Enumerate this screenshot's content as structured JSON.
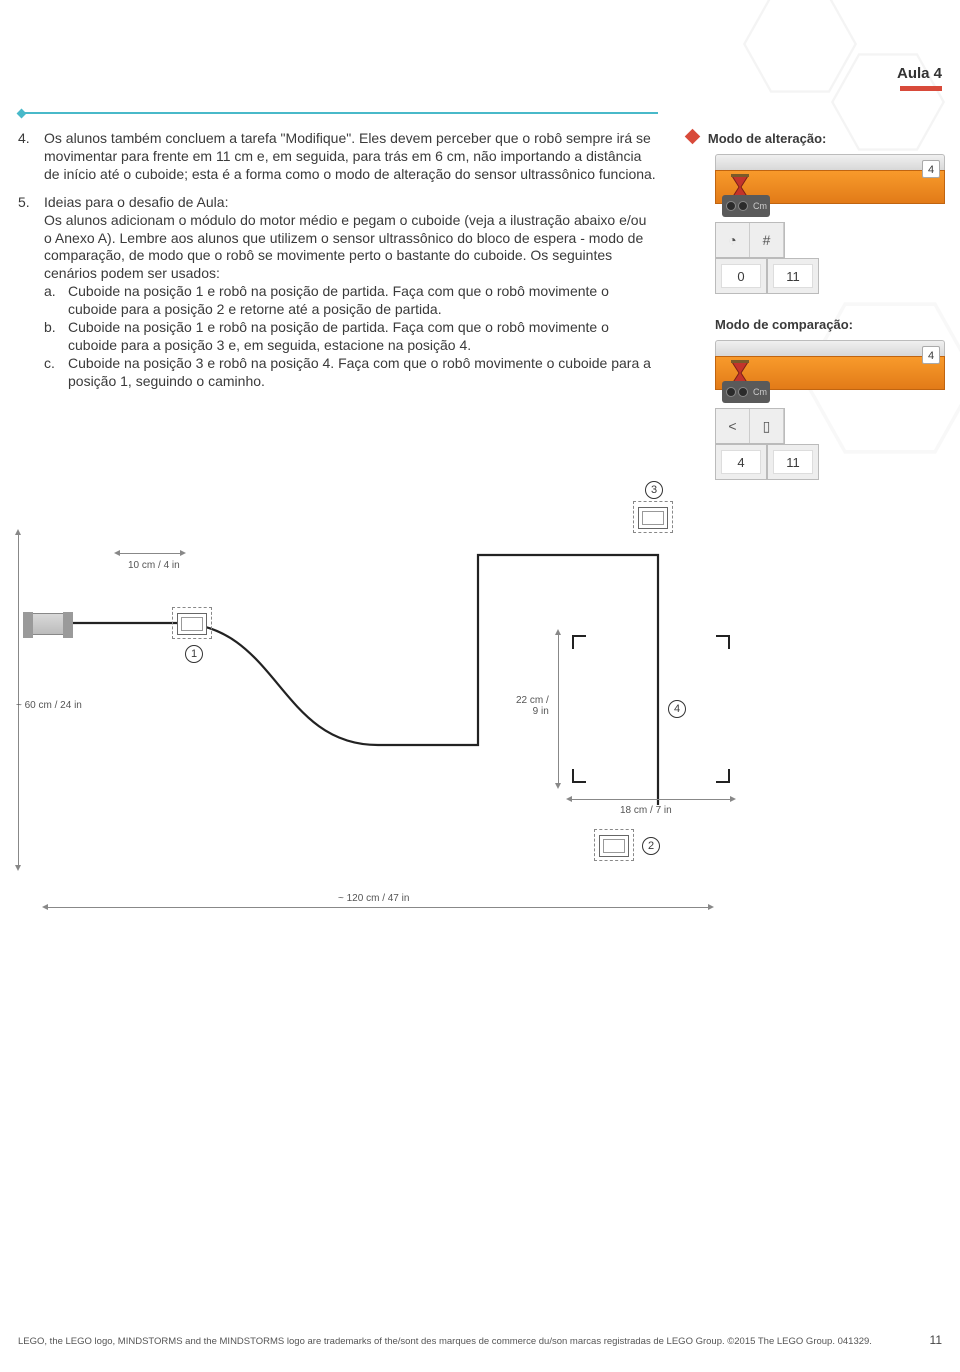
{
  "page": {
    "header": "Aula 4",
    "number": "11"
  },
  "body": {
    "p4_marker": "4.",
    "p4": "Os alunos também concluem a tarefa \"Modifique\". Eles devem perceber que o robô sempre irá se movimentar para frente em 11 cm e, em seguida, para trás em 6 cm, não importando a distância de início até o cuboide; esta é a forma como o modo de alteração do sensor ultrassônico funciona.",
    "p5_marker": "5.",
    "p5_intro": "Ideias para o desafio de Aula:",
    "p5_body1": "Os alunos adicionam o módulo do motor médio e pegam o cuboide (veja a ilustração abaixo e/ou o Anexo A). Lembre aos alunos que utilizem o sensor ultrassônico do bloco de espera - modo de comparação, de modo que o robô se movimente perto o bastante do cuboide. Os seguintes cenários podem ser usados:",
    "a_marker": "a.",
    "a": "Cuboide na posição 1 e robô na posição de partida. Faça com que o robô movimente o cuboide para a posição 2 e retorne até a posição de partida.",
    "b_marker": "b.",
    "b": "Cuboide na posição 1 e robô na posição de partida. Faça com que o robô movimente o cuboide para a posição 3 e, em seguida, estacione na posição 4.",
    "c_marker": "c.",
    "c": "Cuboide na posição 3 e robô na posição 4. Faça com que o robô movimente o cuboide para a posição 1, seguindo o caminho."
  },
  "right": {
    "label1": "Modo de alteração:",
    "label2": "Modo de comparação:",
    "block1": {
      "port": "4",
      "p1_icon": "◔",
      "p1_val": "#",
      "p2_val1": "0",
      "p2_val2": "11"
    },
    "block2": {
      "port": "4",
      "p1_icon": "<",
      "p1_val": "▯",
      "p2_val1": "4",
      "p2_val2": "11"
    }
  },
  "diagram": {
    "m_10cm": "10 cm / 4 in",
    "m_60cm": "~ 60 cm / 24 in",
    "m_22cm": "22 cm /\n9 in",
    "m_18cm": "18 cm / 7 in",
    "m_120cm": "~ 120 cm / 47 in",
    "n1": "1",
    "n2": "2",
    "n3": "3",
    "n4": "4"
  },
  "footer": {
    "line": "LEGO, the LEGO logo, MINDSTORMS and the MINDSTORMS logo are trademarks of the/sont des marques de commerce du/son marcas registradas de LEGO Group. ©2015 The LEGO Group. 041329."
  }
}
